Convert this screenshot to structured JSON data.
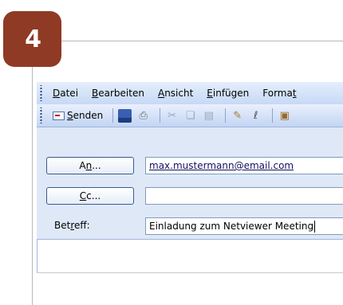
{
  "step": {
    "number": "4"
  },
  "menubar": {
    "items": [
      {
        "label": "Datei",
        "accel": "D",
        "rest": "atei",
        "prefix": ""
      },
      {
        "label": "Bearbeiten",
        "accel": "B",
        "rest": "earbeiten",
        "prefix": ""
      },
      {
        "label": "Ansicht",
        "accel": "A",
        "rest": "nsicht",
        "prefix": ""
      },
      {
        "label": "Einfügen",
        "accel": "E",
        "rest": "infügen",
        "prefix": ""
      },
      {
        "label": "Format",
        "accel": "t",
        "rest": "",
        "prefix": "Forma"
      }
    ]
  },
  "toolbar": {
    "send_label_accel": "S",
    "send_label_rest": "enden",
    "icons": [
      "save-icon",
      "print-icon",
      "cut-icon",
      "copy-icon",
      "paste-icon",
      "signature-icon",
      "attach-icon",
      "address-book-icon"
    ]
  },
  "header": {
    "to_button": {
      "prefix": "A",
      "accel": "n",
      "suffix": "..."
    },
    "cc_button": {
      "prefix": "",
      "accel": "C",
      "suffix": "c..."
    },
    "subject_label": {
      "prefix": "Bet",
      "accel": "r",
      "suffix": "eff:"
    },
    "to_value": "max.mustermann@email.com",
    "cc_value": "",
    "subject_value": "Einladung zum Netviewer Meeting"
  }
}
